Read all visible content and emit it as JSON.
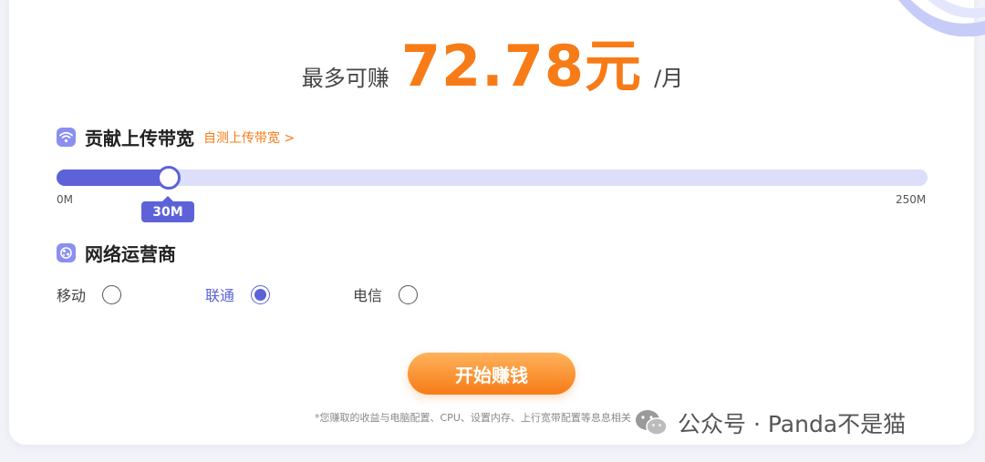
{
  "earnings": {
    "prefix": "最多可赚",
    "amount": "72.78元",
    "unit": "/月"
  },
  "bandwidth": {
    "title": "贡献上传带宽",
    "test_link": "自测上传带宽 >",
    "min_label": "0M",
    "max_label": "250M",
    "value": 30,
    "max": 250,
    "value_label": "30M",
    "icon": "wifi-icon"
  },
  "isp": {
    "title": "网络运营商",
    "icon": "globe-icon",
    "options": [
      {
        "label": "移动",
        "selected": false
      },
      {
        "label": "联通",
        "selected": true
      },
      {
        "label": "电信",
        "selected": false
      }
    ]
  },
  "start_button": "开始赚钱",
  "disclaimer": "*您赚取的收益与电脑配置、CPU、设置内存、上行宽带配置等息息相关",
  "watermark": "公众号 · Panda不是猫",
  "colors": {
    "accent": "#5d62d9",
    "orange": "#f77b16"
  }
}
